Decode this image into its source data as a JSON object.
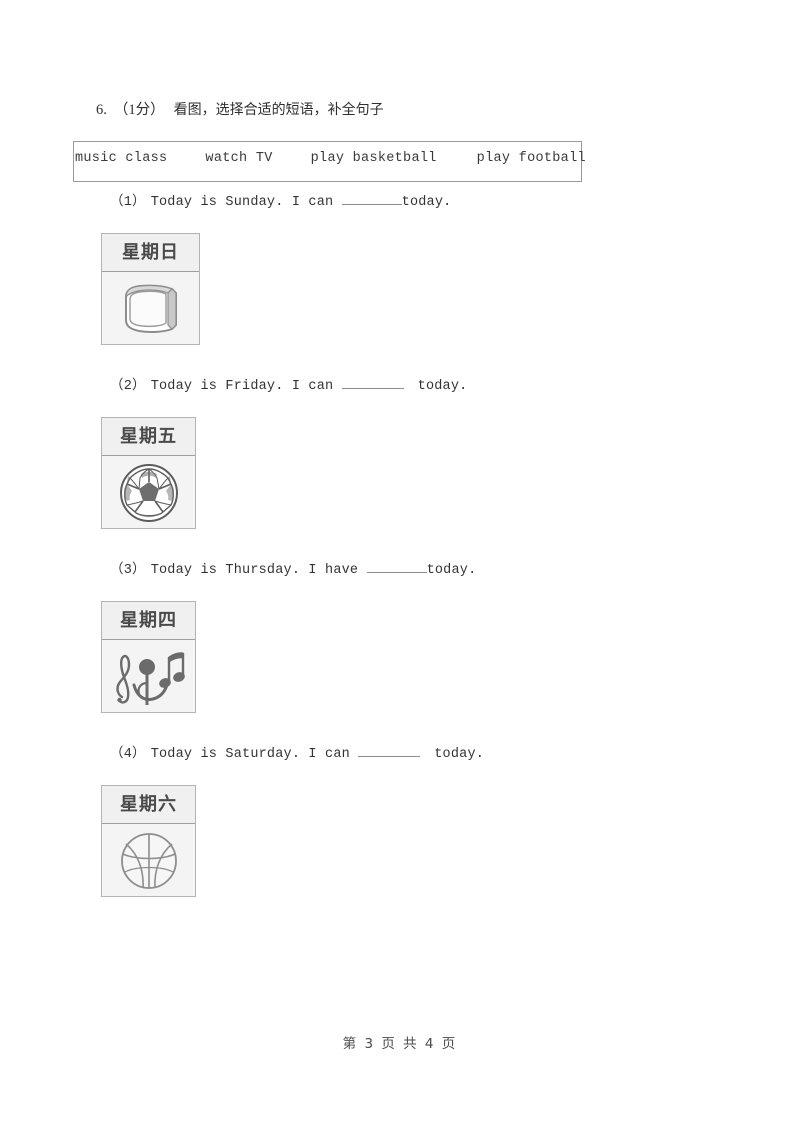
{
  "page": {
    "question_number": "6.",
    "score_tag": "（1分）",
    "prompt": "看图，选择合适的短语，补全句子",
    "footer": "第 3 页 共 4 页"
  },
  "word_bank": {
    "options": [
      "music class",
      "watch TV",
      "play basketball",
      "play football"
    ]
  },
  "items": [
    {
      "label": "（1）",
      "text_before": "Today is Sunday. I can",
      "text_after": "today.",
      "card_day": "星期日",
      "card_icon": "television-icon"
    },
    {
      "label": "（2）",
      "text_before": "Today is Friday. I can",
      "text_after": "today.",
      "card_day": "星期五",
      "card_icon": "soccer-ball-icon"
    },
    {
      "label": "（3）",
      "text_before": "Today is Thursday. I have",
      "text_after": "today.",
      "card_day": "星期四",
      "card_icon": "music-notes-icon"
    },
    {
      "label": "（4）",
      "text_before": "Today is Saturday. I can",
      "text_after": "today.",
      "card_day": "星期六",
      "card_icon": "basketball-icon"
    }
  ]
}
